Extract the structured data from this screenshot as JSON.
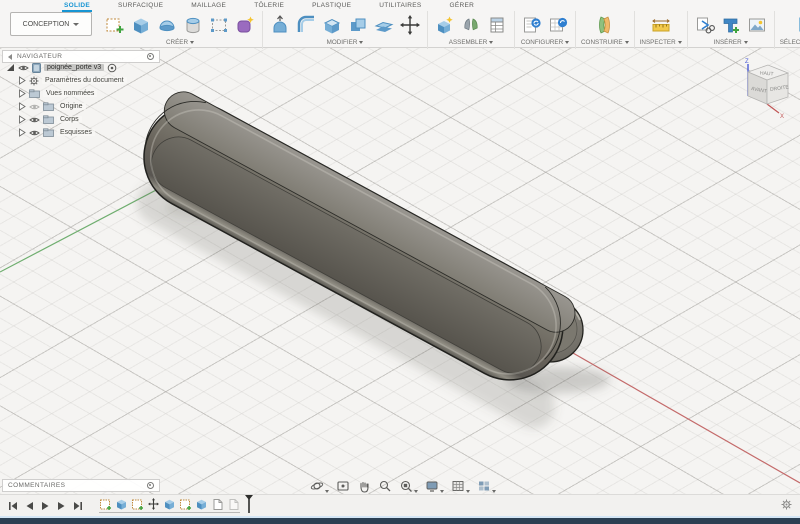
{
  "ribbon": {
    "workspace_label": "CONCEPTION",
    "tabs": [
      {
        "label": "SOLIDE",
        "active": true
      },
      {
        "label": "SURFACIQUE",
        "active": false
      },
      {
        "label": "MAILLAGE",
        "active": false
      },
      {
        "label": "TÔLERIE",
        "active": false
      },
      {
        "label": "PLASTIQUE",
        "active": false
      },
      {
        "label": "UTILITAIRES",
        "active": false
      },
      {
        "label": "GÉRER",
        "active": false
      }
    ],
    "groups": [
      {
        "label": "CRÉER",
        "icons": [
          "create-sketch",
          "extrude",
          "revolve",
          "hole",
          "rectangular-pattern",
          "form"
        ]
      },
      {
        "label": "MODIFIER",
        "icons": [
          "press-pull",
          "fillet",
          "shell",
          "combine",
          "offset-face",
          "move"
        ]
      },
      {
        "label": "ASSEMBLER",
        "icons": [
          "new-component",
          "joint",
          "bom-table"
        ]
      },
      {
        "label": "CONFIGURER",
        "icons": [
          "configure-document",
          "configure-table"
        ]
      },
      {
        "label": "CONSTRUIRE",
        "icons": [
          "construction-plane"
        ]
      },
      {
        "label": "INSPECTER",
        "icons": [
          "measure"
        ]
      },
      {
        "label": "INSÉRER",
        "icons": [
          "insert-derive",
          "insert-mesh",
          "canvas"
        ]
      },
      {
        "label": "SÉLECTIONNER",
        "icons": [
          "select"
        ]
      }
    ]
  },
  "navigator": {
    "title": "NAVIGATEUR",
    "root": {
      "label": "poignée_porte v3",
      "selected": true
    },
    "items": [
      {
        "label": "Paramètres du document",
        "icon": "gear"
      },
      {
        "label": "Vues nommées",
        "icon": "folder"
      },
      {
        "label": "Origine",
        "icon": "folder",
        "eye": "hidden"
      },
      {
        "label": "Corps",
        "icon": "folder",
        "eye": "visible"
      },
      {
        "label": "Esquisses",
        "icon": "folder",
        "eye": "visible"
      }
    ]
  },
  "comments": {
    "title": "COMMENTAIRES"
  },
  "viewcube": {
    "top": "HAUT",
    "front": "AVANT",
    "right": "DROITE",
    "axis_z": "Z",
    "axis_x": "X"
  },
  "timeline": {
    "feature_icons": [
      "sketch",
      "extrude",
      "sketch",
      "move",
      "extrude",
      "sketch",
      "extrude",
      "drawing",
      "drawing"
    ],
    "playback": [
      "go-to-start",
      "step-back",
      "play",
      "step-forward",
      "go-to-end"
    ]
  },
  "navbar_icons": [
    "orbit",
    "look-at",
    "pan",
    "zoom",
    "fit",
    "display-settings",
    "grid-settings",
    "viewports"
  ],
  "colors": {
    "tab_accent": "#1795d3",
    "axis_y_green": "#6fae6f",
    "axis_x_red": "#c46a6a",
    "model_gray": "#6e6b63",
    "select_blue": "#1b82c5",
    "bottom_bar": "#2b3f52"
  }
}
